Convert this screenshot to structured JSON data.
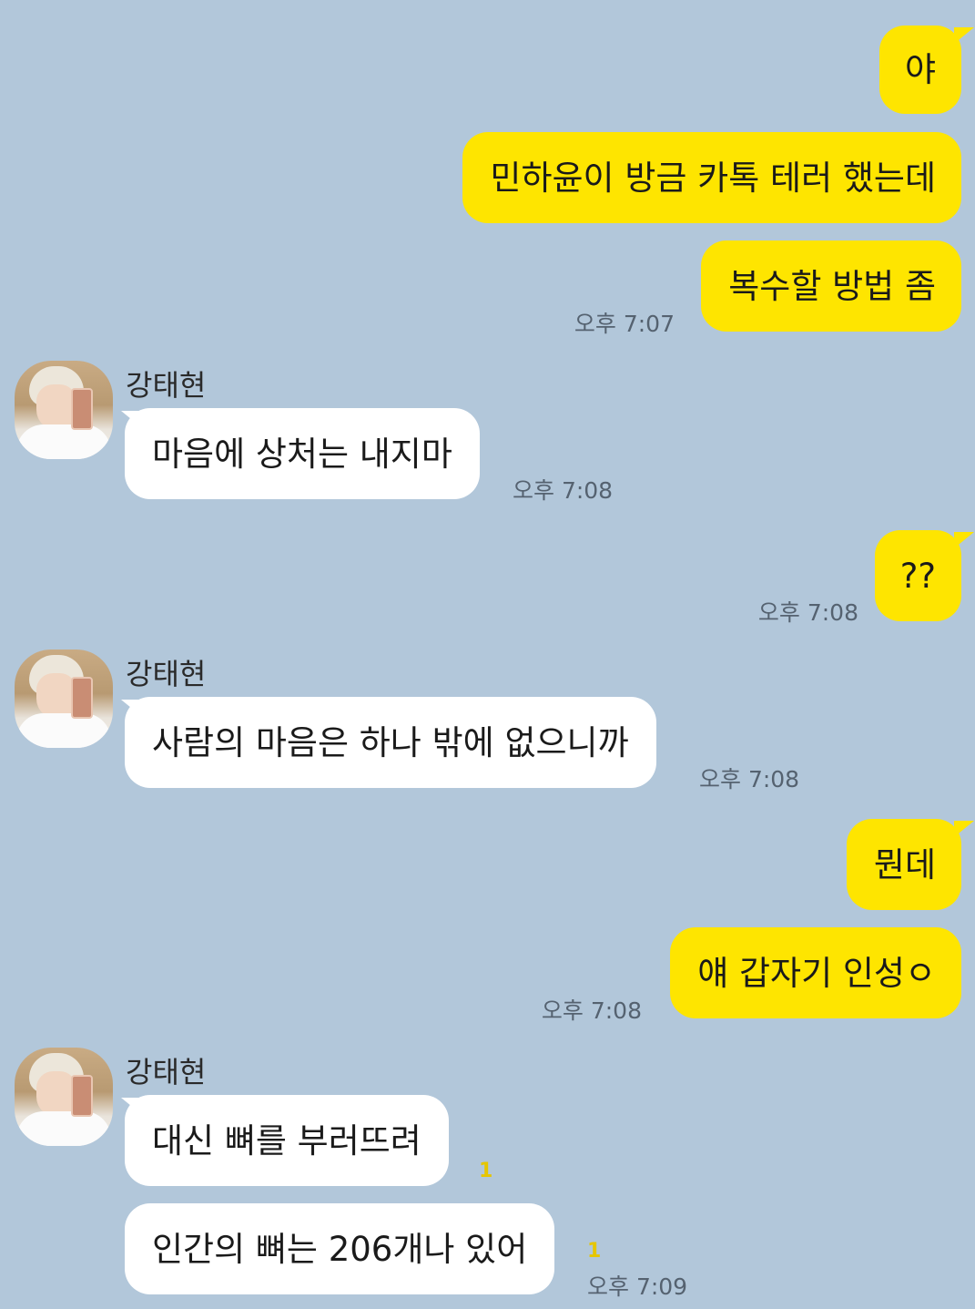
{
  "contact_name": "강태현",
  "colors": {
    "background": "#b2c7da",
    "my_bubble": "#fee500",
    "their_bubble": "#ffffff",
    "unread": "#e6c600"
  },
  "messages": [
    {
      "from": "me",
      "text": "야"
    },
    {
      "from": "me",
      "text": "민하윤이 방금 카톡 테러 했는데"
    },
    {
      "from": "me",
      "text": "복수할 방법 좀",
      "time": "오후 7:07"
    },
    {
      "from": "them",
      "sender": "강태현",
      "text": "마음에 상처는 내지마",
      "time": "오후 7:08"
    },
    {
      "from": "me",
      "text": "??",
      "time": "오후 7:08"
    },
    {
      "from": "them",
      "sender": "강태현",
      "text": "사람의 마음은 하나 밖에 없으니까",
      "time": "오후 7:08"
    },
    {
      "from": "me",
      "text": "뭔데"
    },
    {
      "from": "me",
      "text": "얘 갑자기 인성ㅇ",
      "time": "오후 7:08"
    },
    {
      "from": "them",
      "sender": "강태현",
      "text": "대신 뼈를 부러뜨려",
      "unread": "1"
    },
    {
      "from": "them",
      "text": "인간의 뼈는 206개나 있어",
      "unread": "1",
      "time": "오후 7:09"
    }
  ]
}
